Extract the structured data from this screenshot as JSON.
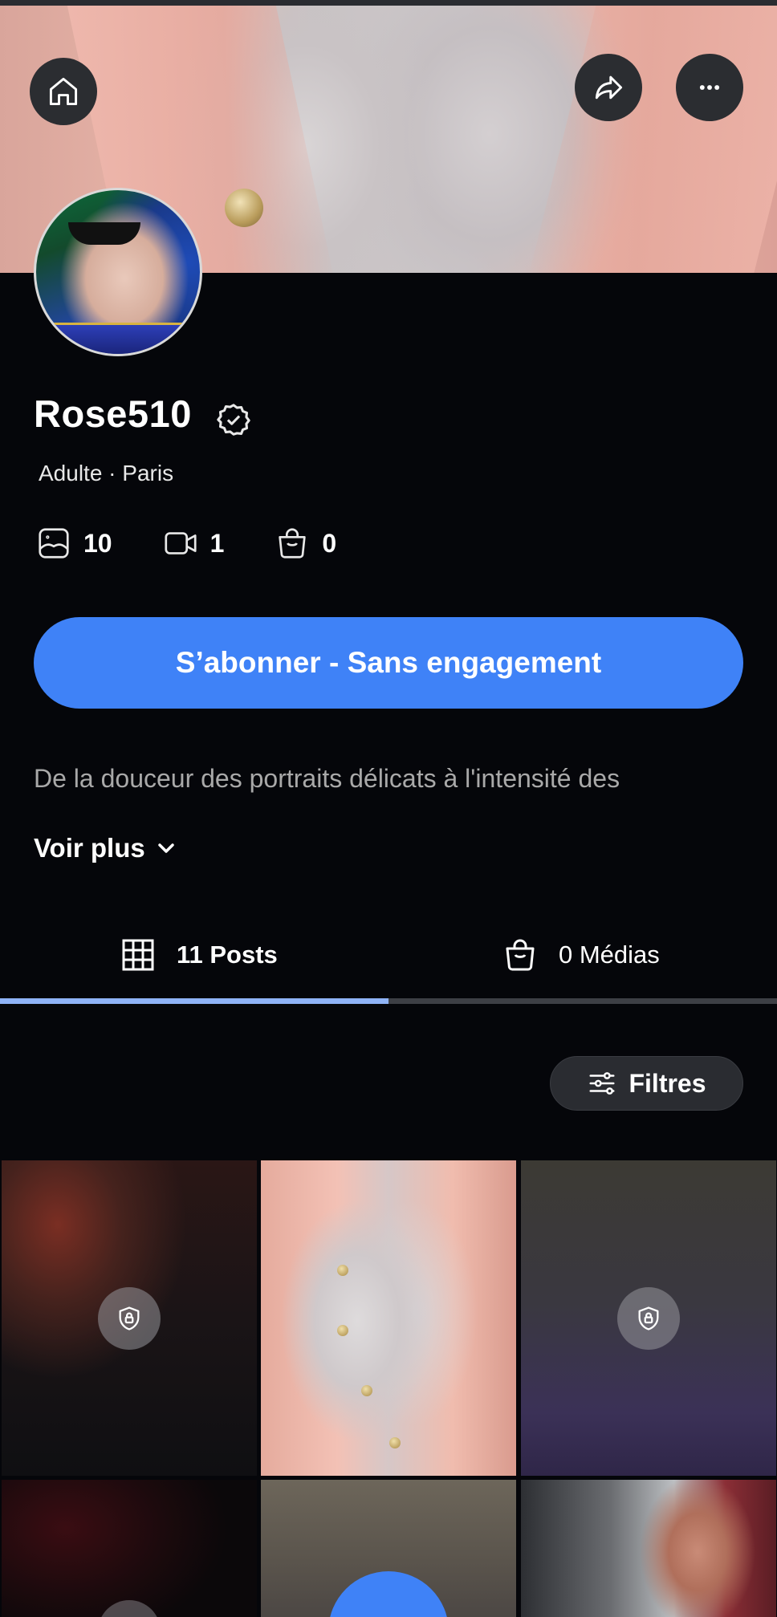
{
  "profile": {
    "name": "Rose510",
    "meta": "Adulte · Paris"
  },
  "stats": {
    "photos": "10",
    "videos": "1",
    "shop": "0"
  },
  "subscribe_label": "S’abonner - Sans engagement",
  "bio": "De la douceur des portraits délicats à l'intensité des",
  "voir_plus_label": "Voir plus",
  "tabs": {
    "posts_label": "11 Posts",
    "medias_label": "0 Médias"
  },
  "filters_label": "Filtres",
  "colors": {
    "accent": "#3f82f7",
    "tab_indicator": "#8fb3f6",
    "background": "#05060a"
  },
  "icons": {
    "home": "home-icon",
    "share": "share-icon",
    "more": "more-icon",
    "verified": "verified-badge-icon",
    "photo": "photo-icon",
    "video": "video-icon",
    "bag": "shopping-bag-icon",
    "grid": "grid-icon",
    "chevron": "chevron-down-icon",
    "filters": "sliders-icon",
    "lock": "lock-icon"
  }
}
